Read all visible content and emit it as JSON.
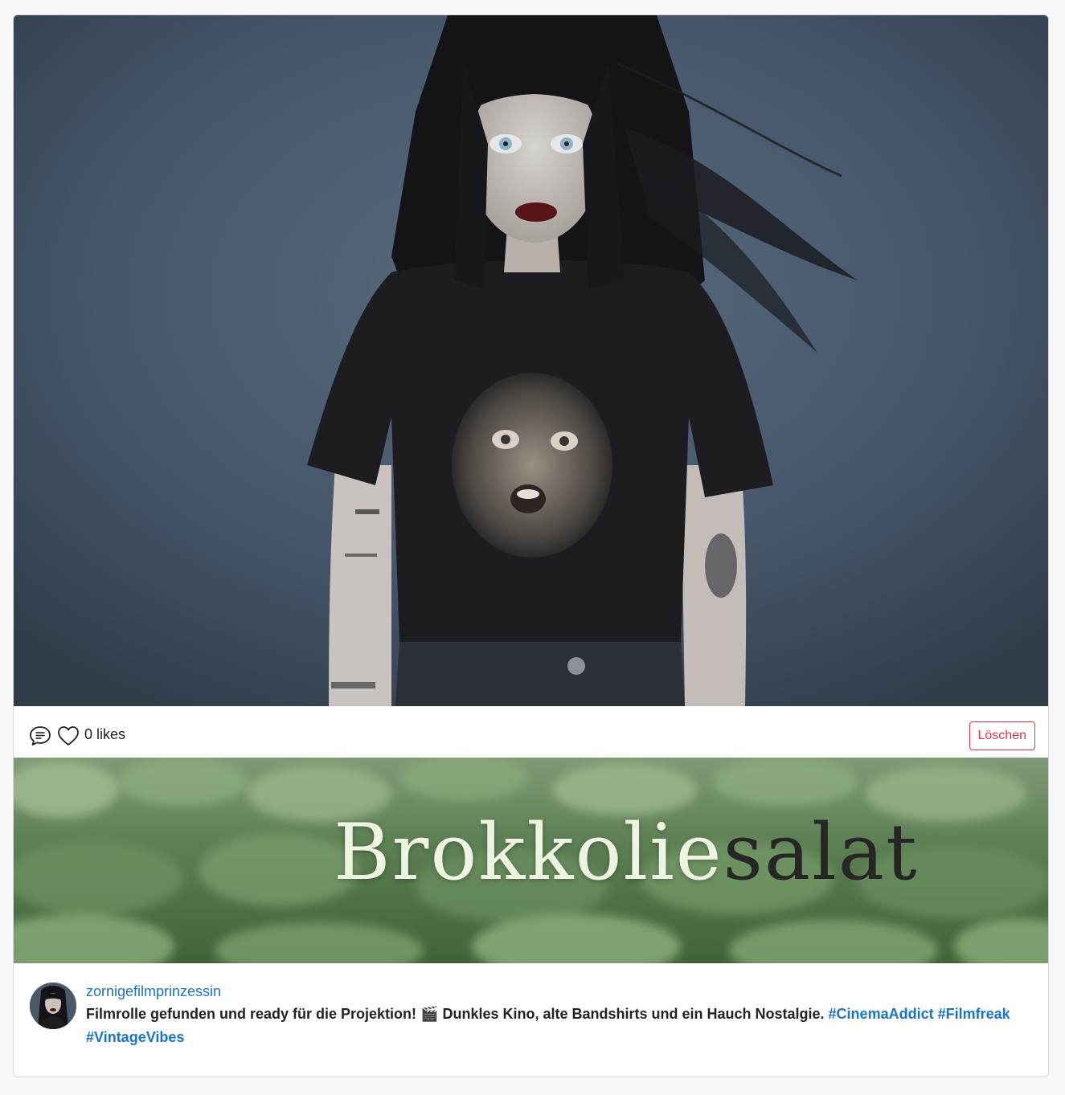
{
  "post": {
    "image_alt": "Portrait photo of a young woman with long black hair and a black graphic t-shirt",
    "actions": {
      "comment_icon": "comment-icon",
      "like_icon": "heart-icon",
      "likes_text": "0 likes",
      "delete_label": "Löschen"
    },
    "banner": {
      "title_light": "Brokkolie",
      "title_dark": "salat"
    },
    "author": {
      "username": "zornigefilmprinzessin"
    },
    "caption": {
      "text_1": "Filmrolle gefunden und ready für die Projektion! ",
      "emoji": "🎬",
      "text_2": " Dunkles Kino, alte Bandshirts und ein Hauch Nostalgie. ",
      "hashtags": [
        "#CinemaAddict",
        "#Filmfreak",
        "#VintageVibes"
      ]
    }
  },
  "colors": {
    "link": "#1a73c8",
    "danger": "#dc3545",
    "border": "#d6d8db"
  }
}
